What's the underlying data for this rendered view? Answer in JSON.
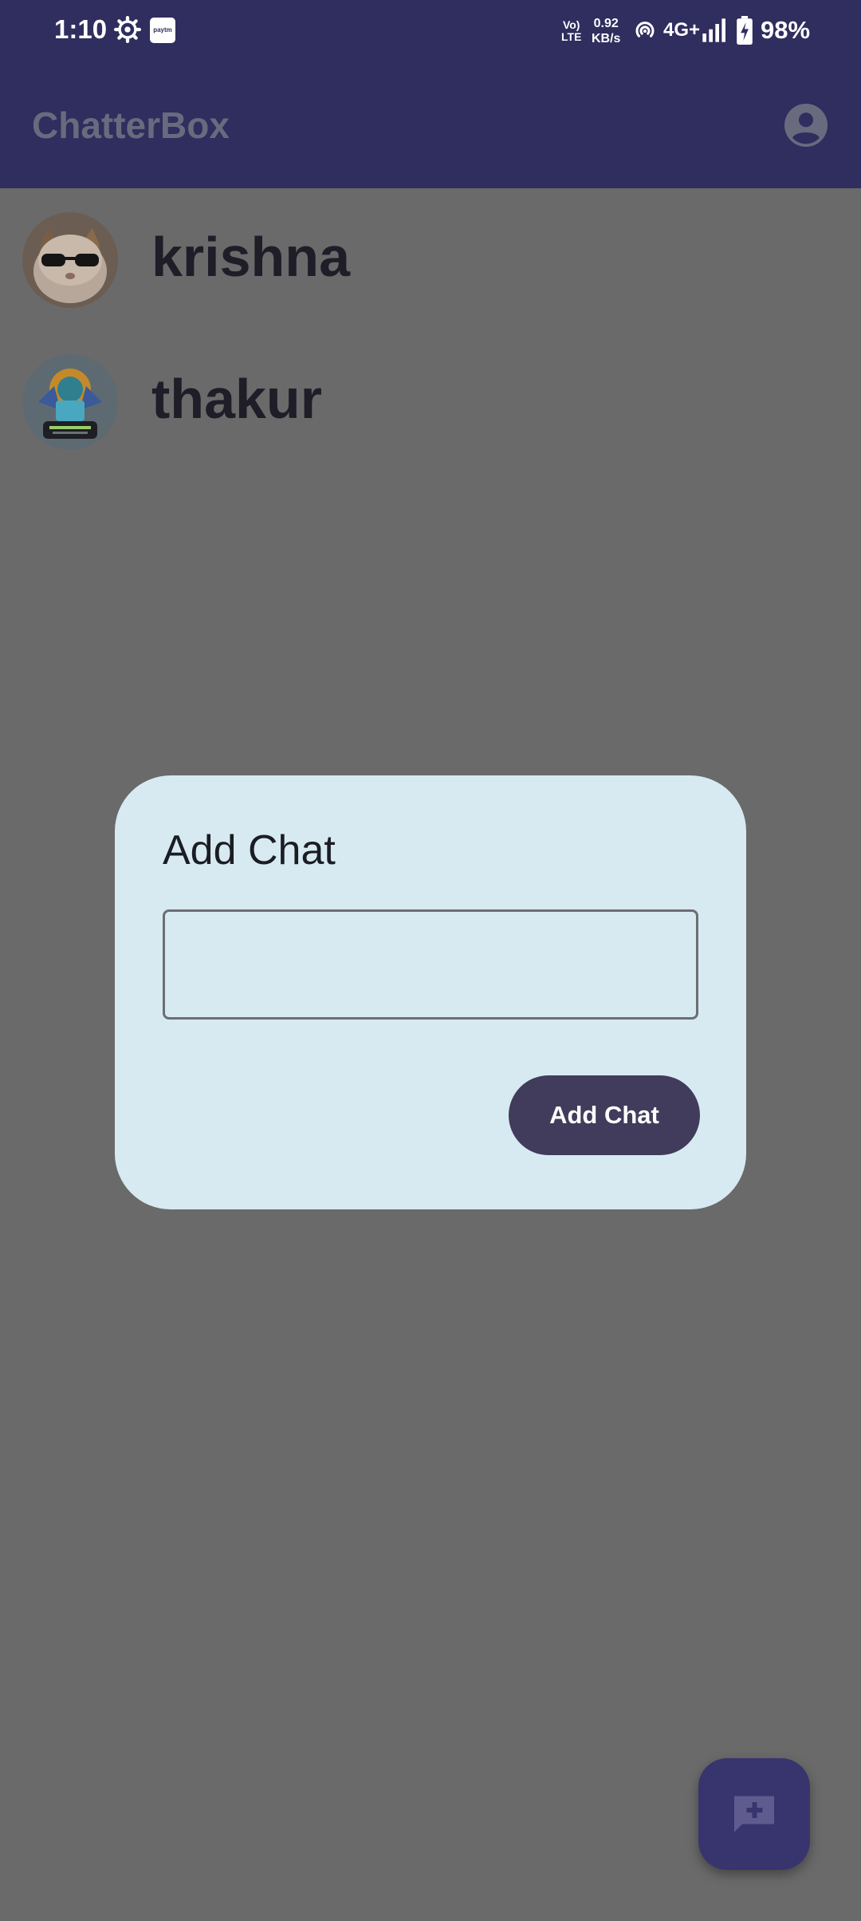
{
  "status_bar": {
    "time": "1:10",
    "volte": "Vo) LTE",
    "volte_line1": "Vo)",
    "volte_line2": "LTE",
    "speed_line1": "0.92",
    "speed_line2": "KB/s",
    "network": "4G+",
    "battery": "98%",
    "paytm_label": "paytm"
  },
  "app_bar": {
    "title": "ChatterBox",
    "profile_icon": "account-circle-icon"
  },
  "chats": [
    {
      "name": "krishna",
      "avatar": "cat-with-sunglasses"
    },
    {
      "name": "thakur",
      "avatar": "androidd-logo"
    }
  ],
  "dialog": {
    "title": "Add Chat",
    "input_value": "",
    "button_label": "Add Chat"
  },
  "fab": {
    "icon": "add-chat-icon"
  },
  "colors": {
    "app_bar": "#302d5f",
    "scrim": "#6a6a6a",
    "dialog_bg": "#d8eaf1",
    "button_bg": "#413c5b",
    "fab_bg": "#38346e"
  }
}
